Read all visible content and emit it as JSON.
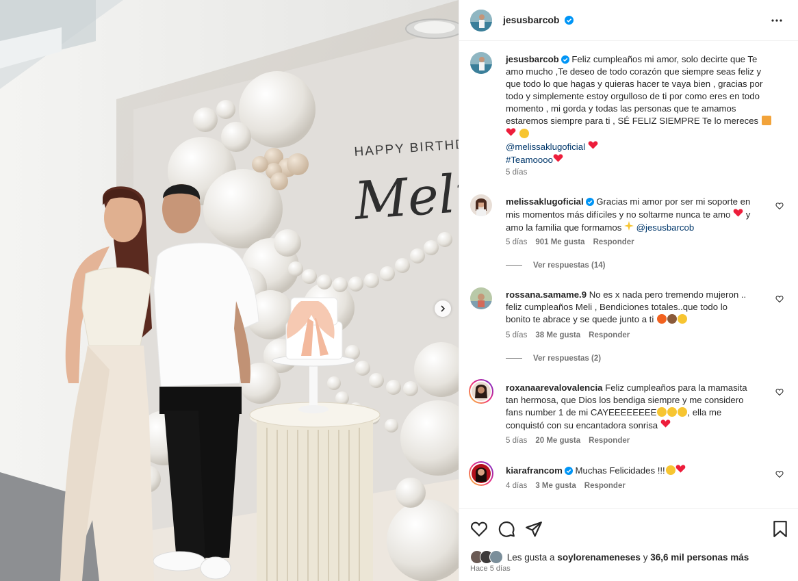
{
  "photo": {
    "banner_text": "HAPPY BIRTHDA",
    "script_text": "Melis",
    "next_button": "chevron-right-icon"
  },
  "post": {
    "author": "jesusbarcob",
    "more_icon": "more-options-icon",
    "caption": {
      "username": "jesusbarcob",
      "text": "Feliz cumpleaños mi amor, solo decirte que Te amo mucho ,Te deseo de todo corazón que siempre seas feliz y que todo lo que hagas y quieras hacer te vaya bien , gracias por todo y simplemente estoy orgulloso de ti por como eres en todo momento , mi gorda y todas las personas que te amamos estaremos siempre para ti , SÉ FELIZ SIEMPRE Te lo mereces",
      "mention": "@melissaklugoficial",
      "hashtag": "#Teamoooo",
      "time": "5 días"
    },
    "comments": [
      {
        "username": "melissaklugoficial",
        "verified": true,
        "text": "Gracias mi amor por ser mi soporte en mis momentos más difíciles y no soltarme nunca te amo",
        "text2": "y amo la familia que formamos",
        "mention": "@jesusbarcob",
        "time": "5 días",
        "likes": "901 Me gusta",
        "reply": "Responder",
        "view_replies": "Ver respuestas (14)"
      },
      {
        "username": "rossana.samame.9",
        "verified": false,
        "text": "No es x nada pero tremendo mujeron .. feliz cumpleaños Meli , Bendiciones totales..que todo lo bonito te abrace y se quede junto a ti",
        "time": "5 días",
        "likes": "38 Me gusta",
        "reply": "Responder",
        "view_replies": "Ver respuestas (2)"
      },
      {
        "username": "roxanaarevalovalencia",
        "verified": false,
        "text": "Feliz cumpleaños para la mamasita tan hermosa, que Dios los bendiga siempre y me considero fans number 1 de mi CAYEEEEEEEE",
        "text2": ", ella me conquistó con su encantadora sonrisa",
        "time": "5 días",
        "likes": "20 Me gusta",
        "reply": "Responder"
      },
      {
        "username": "kiarafrancom",
        "verified": true,
        "text": "Muchas Felicidades !!!",
        "time": "4 días",
        "likes": "3 Me gusta",
        "reply": "Responder"
      }
    ],
    "actions": {
      "like_icon": "heart-icon",
      "comment_icon": "comment-icon",
      "share_icon": "share-icon",
      "save_icon": "bookmark-icon"
    },
    "likes_prefix": "Les gusta a",
    "likes_user": "soylorenameneses",
    "likes_mid": "y",
    "likes_others": "36,6 mil personas más",
    "posted": "Hace 5 días"
  },
  "colors": {
    "verified": "#0095f6",
    "text": "#262626",
    "secondary": "#737373",
    "link": "#00376b",
    "heart": "#ed1d3b"
  }
}
